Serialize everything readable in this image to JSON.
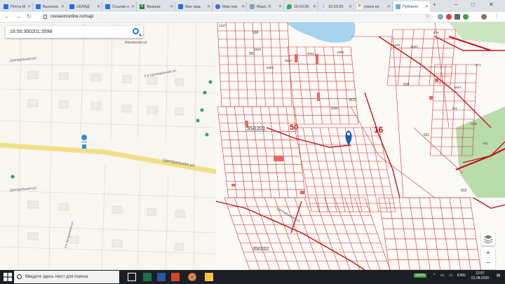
{
  "browser": {
    "tabs": [
      {
        "label": "Почта М",
        "icon": "blue-square-icon"
      },
      {
        "label": "Выписки",
        "icon": "blue-square-icon"
      },
      {
        "label": "СКЛАД",
        "icon": "blue-square-icon"
      },
      {
        "label": "Ссылки н",
        "icon": "blue-square-icon"
      },
      {
        "label": "Франци",
        "icon": "excel-icon"
      },
      {
        "label": "Фин мод",
        "icon": "blue-square-icon"
      },
      {
        "label": "Мир пер",
        "icon": "globe-icon"
      },
      {
        "label": "Марс, Л",
        "icon": "map-icon"
      },
      {
        "label": "16:50:35",
        "icon": "maps-pin-icon"
      },
      {
        "label": "16:50:35",
        "icon": "google-icon"
      },
      {
        "label": "поиск ка",
        "icon": "yandex-icon"
      },
      {
        "label": "Публичн",
        "icon": "rosreestr-icon"
      }
    ],
    "url": "rosreestronline.ru/map/",
    "window_controls": [
      "–",
      "□",
      "✕"
    ],
    "nav": {
      "back": "←",
      "forward": "→",
      "reload": "↻"
    }
  },
  "map": {
    "search_value": "16:50:350201:3598",
    "quarter_labels": [
      "350201",
      "50",
      "16",
      "350202"
    ],
    "street_labels": [
      "Центральная ул.",
      "Центральная ул.",
      "2-я Центральная ул.",
      "Алеевская ул.",
      "Айя",
      "Центральная ул.",
      "1-я Заовражная ул."
    ],
    "parcel_numbers": [
      "938",
      "951",
      "1300",
      "3615",
      "3095",
      "3617",
      "630",
      "631",
      "632",
      "479",
      "1243",
      "1128",
      "671",
      "1218",
      "761",
      "611",
      "1128",
      "1136",
      "1044",
      "1246",
      "1267",
      "1258",
      "1227",
      "2819",
      "3694",
      "4032",
      "4068"
    ],
    "colors": {
      "parcel_line": "#d1312e",
      "boundary": "#c0141b",
      "water": "#a8d3ee",
      "road": "#f7e9a0",
      "pin": "#1a5fb4"
    }
  },
  "taskbar": {
    "search_placeholder": "Введите здесь текст для поиска",
    "battery": "100%",
    "lang": "ENG",
    "time": "12:57",
    "date": "01.08.2020"
  }
}
